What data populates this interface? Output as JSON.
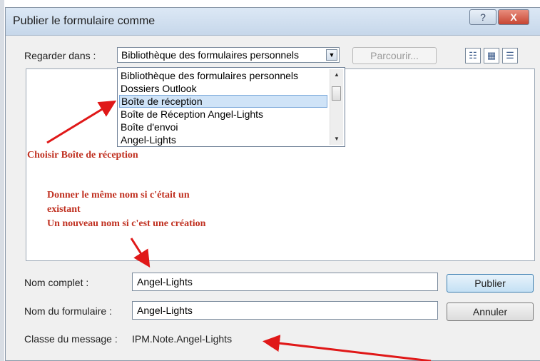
{
  "window": {
    "title": "Publier le formulaire comme",
    "help_label": "?",
    "close_label": "X"
  },
  "look_in": {
    "label": "Regarder dans :",
    "value": "Bibliothèque des formulaires personnels",
    "browse_label": "Parcourir..."
  },
  "dropdown": {
    "options": [
      "Bibliothèque des formulaires personnels",
      "Dossiers Outlook",
      "Boîte de réception",
      "Boîte de Réception Angel-Lights",
      "Boîte d'envoi",
      "Angel-Lights"
    ],
    "selected_index": 2
  },
  "annotations": {
    "choose": "Choisir Boîte de réception",
    "name_line1": "Donner le même nom si c'était un",
    "name_line2": "existant",
    "name_line3": "Un nouveau nom si c'est une création"
  },
  "form": {
    "full_name_label": "Nom complet :",
    "full_name_value": "Angel-Lights",
    "form_name_label": "Nom du formulaire :",
    "form_name_value": "Angel-Lights",
    "class_label": "Classe du message :",
    "class_value": "IPM.Note.Angel-Lights"
  },
  "buttons": {
    "publish": "Publier",
    "cancel": "Annuler"
  },
  "colors": {
    "annotation": "#c03020",
    "arrow": "#e01818",
    "selection": "#cfe3f7"
  }
}
